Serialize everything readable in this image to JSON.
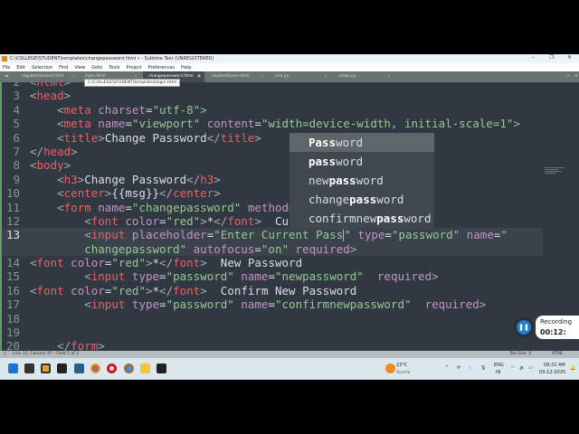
{
  "window": {
    "title": "C:\\COLLEGE\\STUDENT\\templates\\changepassword.html • - Sublime Text (UNREGISTERED)",
    "minimize": "–",
    "maximize": "❐",
    "close": "✕"
  },
  "menu": [
    "File",
    "Edit",
    "Selection",
    "Find",
    "View",
    "Goto",
    "Tools",
    "Project",
    "Preferences",
    "Help"
  ],
  "tabs": [
    {
      "label": "registerstudent.html",
      "active": false
    },
    {
      "label": "login.html",
      "active": false
    },
    {
      "label": "changepassword.html",
      "active": true
    },
    {
      "label": "studenthome.html",
      "active": false
    },
    {
      "label": "urls.py",
      "active": false
    },
    {
      "label": "views.py",
      "active": false
    }
  ],
  "tooltip": "C:\\COLLEGE\\STUDENT\\templates\\login.html",
  "code": [
    {
      "n": "2",
      "s": [
        [
          "p",
          "<"
        ],
        [
          "tag",
          "html"
        ],
        [
          "p",
          ">"
        ]
      ]
    },
    {
      "n": "3",
      "s": [
        [
          "p",
          "<"
        ],
        [
          "tag",
          "head"
        ],
        [
          "p",
          ">"
        ]
      ]
    },
    {
      "n": "4",
      "s": [
        [
          "t",
          "    "
        ],
        [
          "p",
          "<"
        ],
        [
          "tag",
          "meta"
        ],
        [
          "t",
          " "
        ],
        [
          "attr",
          "charset"
        ],
        [
          "t",
          "="
        ],
        [
          "str",
          "\"utf-8\""
        ],
        [
          "p",
          ">"
        ]
      ]
    },
    {
      "n": "5",
      "s": [
        [
          "t",
          "    "
        ],
        [
          "p",
          "<"
        ],
        [
          "tag",
          "meta"
        ],
        [
          "t",
          " "
        ],
        [
          "attr",
          "name"
        ],
        [
          "t",
          "="
        ],
        [
          "str",
          "\"viewport\""
        ],
        [
          "t",
          " "
        ],
        [
          "attr",
          "content"
        ],
        [
          "t",
          "="
        ],
        [
          "str",
          "\"width=device-width, initial-scale=1\""
        ],
        [
          "p",
          ">"
        ]
      ]
    },
    {
      "n": "6",
      "s": [
        [
          "t",
          "    "
        ],
        [
          "p",
          "<"
        ],
        [
          "tag",
          "title"
        ],
        [
          "p",
          ">"
        ],
        [
          "t",
          "Change Password"
        ],
        [
          "p",
          "</"
        ],
        [
          "tag",
          "title"
        ],
        [
          "p",
          ">"
        ]
      ]
    },
    {
      "n": "7",
      "s": [
        [
          "p",
          "</"
        ],
        [
          "tag",
          "head"
        ],
        [
          "p",
          ">"
        ]
      ]
    },
    {
      "n": "8",
      "s": [
        [
          "p",
          "<"
        ],
        [
          "tag",
          "body"
        ],
        [
          "p",
          ">"
        ]
      ]
    },
    {
      "n": "9",
      "s": [
        [
          "t",
          "    "
        ],
        [
          "p",
          "<"
        ],
        [
          "tag",
          "h3"
        ],
        [
          "p",
          ">"
        ],
        [
          "t",
          "Change Password"
        ],
        [
          "p",
          "</"
        ],
        [
          "tag",
          "h3"
        ],
        [
          "p",
          ">"
        ]
      ]
    },
    {
      "n": "10",
      "s": [
        [
          "t",
          "    "
        ],
        [
          "p",
          "<"
        ],
        [
          "tag",
          "center"
        ],
        [
          "p",
          ">"
        ],
        [
          "t",
          "{{msg}}"
        ],
        [
          "p",
          "</"
        ],
        [
          "tag",
          "center"
        ],
        [
          "p",
          ">"
        ]
      ]
    },
    {
      "n": "11",
      "s": [
        [
          "t",
          "    "
        ],
        [
          "p",
          "<"
        ],
        [
          "tag",
          "form"
        ],
        [
          "t",
          " "
        ],
        [
          "attr",
          "name"
        ],
        [
          "t",
          "="
        ],
        [
          "str",
          "\"changepassword\""
        ],
        [
          "t",
          " "
        ],
        [
          "attr",
          "method"
        ],
        [
          "t",
          "="
        ],
        [
          "str",
          "\""
        ]
      ]
    },
    {
      "n": "12",
      "s": [
        [
          "t",
          "        "
        ],
        [
          "p",
          "<"
        ],
        [
          "tag",
          "font"
        ],
        [
          "t",
          " "
        ],
        [
          "attr",
          "color"
        ],
        [
          "t",
          "="
        ],
        [
          "str",
          "\"red\""
        ],
        [
          "p",
          ">"
        ],
        [
          "t",
          "*"
        ],
        [
          "p",
          "</"
        ],
        [
          "tag",
          "font"
        ],
        [
          "p",
          ">"
        ],
        [
          "t",
          "  Curr"
        ]
      ]
    },
    {
      "n": "13",
      "cur": true,
      "s": [
        [
          "t",
          "        "
        ],
        [
          "p",
          "<"
        ],
        [
          "tag",
          "input"
        ],
        [
          "t",
          " "
        ],
        [
          "attr",
          "placeholder"
        ],
        [
          "t",
          "="
        ],
        [
          "str",
          "\"Enter Current Pass"
        ],
        [
          "cursor",
          ""
        ],
        [
          "str",
          "\""
        ],
        [
          "t",
          " "
        ],
        [
          "attr",
          "type"
        ],
        [
          "t",
          "="
        ],
        [
          "str",
          "\"password\""
        ],
        [
          "t",
          " "
        ],
        [
          "attr",
          "name"
        ],
        [
          "t",
          "="
        ],
        [
          "str",
          "\""
        ]
      ]
    },
    {
      "n": "",
      "cur": true,
      "s": [
        [
          "t",
          "        "
        ],
        [
          "str",
          "changepassword\""
        ],
        [
          "t",
          " "
        ],
        [
          "attr",
          "autofocus"
        ],
        [
          "t",
          "="
        ],
        [
          "str",
          "\"on\""
        ],
        [
          "t",
          " "
        ],
        [
          "attr",
          "required"
        ],
        [
          "p",
          ">"
        ]
      ]
    },
    {
      "n": "14",
      "s": [
        [
          "p",
          "<"
        ],
        [
          "tag",
          "font"
        ],
        [
          "t",
          " "
        ],
        [
          "attr",
          "color"
        ],
        [
          "t",
          "="
        ],
        [
          "str",
          "\"red\""
        ],
        [
          "p",
          ">"
        ],
        [
          "t",
          "*"
        ],
        [
          "p",
          "</"
        ],
        [
          "tag",
          "font"
        ],
        [
          "p",
          ">"
        ],
        [
          "t",
          "  New Password"
        ]
      ]
    },
    {
      "n": "15",
      "s": [
        [
          "t",
          "        "
        ],
        [
          "p",
          "<"
        ],
        [
          "tag",
          "input"
        ],
        [
          "t",
          " "
        ],
        [
          "attr",
          "type"
        ],
        [
          "t",
          "="
        ],
        [
          "str",
          "\"password\""
        ],
        [
          "t",
          " "
        ],
        [
          "attr",
          "name"
        ],
        [
          "t",
          "="
        ],
        [
          "str",
          "\"newpassword\""
        ],
        [
          "t",
          "  "
        ],
        [
          "attr",
          "required"
        ],
        [
          "p",
          ">"
        ]
      ]
    },
    {
      "n": "16",
      "s": [
        [
          "p",
          "<"
        ],
        [
          "tag",
          "font"
        ],
        [
          "t",
          " "
        ],
        [
          "attr",
          "color"
        ],
        [
          "t",
          "="
        ],
        [
          "str",
          "\"red\""
        ],
        [
          "p",
          ">"
        ],
        [
          "t",
          "*"
        ],
        [
          "p",
          "</"
        ],
        [
          "tag",
          "font"
        ],
        [
          "p",
          ">"
        ],
        [
          "t",
          "  Confirm New Password"
        ]
      ]
    },
    {
      "n": "17",
      "s": [
        [
          "t",
          "        "
        ],
        [
          "p",
          "<"
        ],
        [
          "tag",
          "input"
        ],
        [
          "t",
          " "
        ],
        [
          "attr",
          "type"
        ],
        [
          "t",
          "="
        ],
        [
          "str",
          "\"password\""
        ],
        [
          "t",
          " "
        ],
        [
          "attr",
          "name"
        ],
        [
          "t",
          "="
        ],
        [
          "str",
          "\"confirmnewpassword\""
        ],
        [
          "t",
          "  "
        ],
        [
          "attr",
          "required"
        ],
        [
          "p",
          ">"
        ]
      ]
    },
    {
      "n": "18",
      "s": []
    },
    {
      "n": "19",
      "s": []
    },
    {
      "n": "20",
      "s": [
        [
          "t",
          "    "
        ],
        [
          "p",
          "</"
        ],
        [
          "tag",
          "form"
        ],
        [
          "p",
          ">"
        ]
      ]
    }
  ],
  "autocomplete": [
    {
      "pre": "",
      "match": "Pass",
      "post": "word"
    },
    {
      "pre": "",
      "match": "pass",
      "post": "word"
    },
    {
      "pre": "new",
      "match": "pass",
      "post": "word"
    },
    {
      "pre": "change",
      "match": "pass",
      "post": "word"
    },
    {
      "pre": "confirmnew",
      "match": "pass",
      "post": "word"
    }
  ],
  "recording": {
    "label": "Recording",
    "time": "00:12:"
  },
  "status": {
    "position": "Line 13, Column 47 - Field 1 of 2",
    "tab_size": "Tab Size: 4",
    "syntax": "HTML"
  },
  "taskbar": {
    "temp": "23°C",
    "weather": "Sunny",
    "lang1": "ENG",
    "lang2": "IN",
    "time": "09:32 AM",
    "date": "03-12-2025"
  }
}
